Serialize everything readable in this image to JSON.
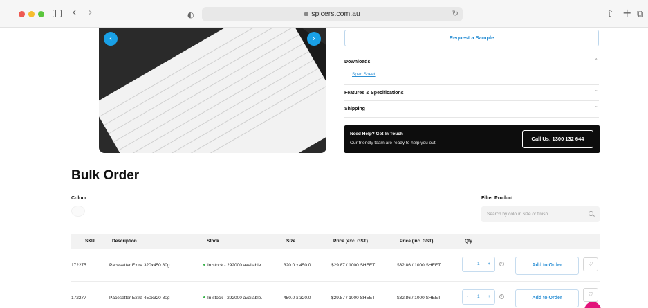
{
  "browser": {
    "url": "spicers.com.au",
    "back_icon": "‹",
    "forward_icon": "›",
    "shield_icon": "◐",
    "reload_icon": "↻",
    "share_icon": "⇧",
    "new_tab_icon": "+",
    "tabs_icon": "⧉"
  },
  "carousel": {
    "prev_icon": "‹",
    "next_icon": "›"
  },
  "product_info": {
    "request_sample": "Request a Sample",
    "downloads_title": "Downloads",
    "spec_sheet_link": "Spec Sheet",
    "features_title": "Features & Specifications",
    "shipping_title": "Shipping",
    "chevron_up": "˄",
    "chevron_down": "˅"
  },
  "help": {
    "title": "Need Help? Get In Touch",
    "subtitle": "Our friendly team are ready to help you out!",
    "call_button": "Call Us: 1300 132 644"
  },
  "bulk_order": {
    "title": "Bulk Order",
    "colour_label": "Colour",
    "filter_label": "Filter Product",
    "filter_placeholder": "Search by colour, size or finish",
    "columns": {
      "sku": "SKU",
      "description": "Description",
      "stock": "Stock",
      "size": "Size",
      "price_ex": "Price (exc. GST)",
      "price_inc": "Price (inc. GST)",
      "qty": "Qty"
    },
    "rows": [
      {
        "sku": "172275",
        "description": "Pacesetter Extra 320x450 80g",
        "stock": "In stock - 292000 available.",
        "size": "320.0 x 450.0",
        "price_ex": "$29.87 / 1000 SHEET",
        "price_inc": "$32.86 / 1000 SHEET",
        "qty": "1",
        "add_button": "Add to Order"
      },
      {
        "sku": "172277",
        "description": "Pacesetter Extra 450x320 80g",
        "stock": "In stock - 292000 available.",
        "size": "450.0 x 320.0",
        "price_ex": "$29.87 / 1000 SHEET",
        "price_inc": "$32.86 / 1000 SHEET",
        "qty": "1",
        "add_button": "Add to Order"
      }
    ],
    "qty_minus": "-",
    "qty_plus": "+",
    "info_icon": "i",
    "wishlist_icon": "♡"
  },
  "colors": {
    "accent": "#2b8fd4",
    "carousel": "#19a0e6",
    "chat": "#e2137a",
    "stock_green": "#38b24a"
  }
}
